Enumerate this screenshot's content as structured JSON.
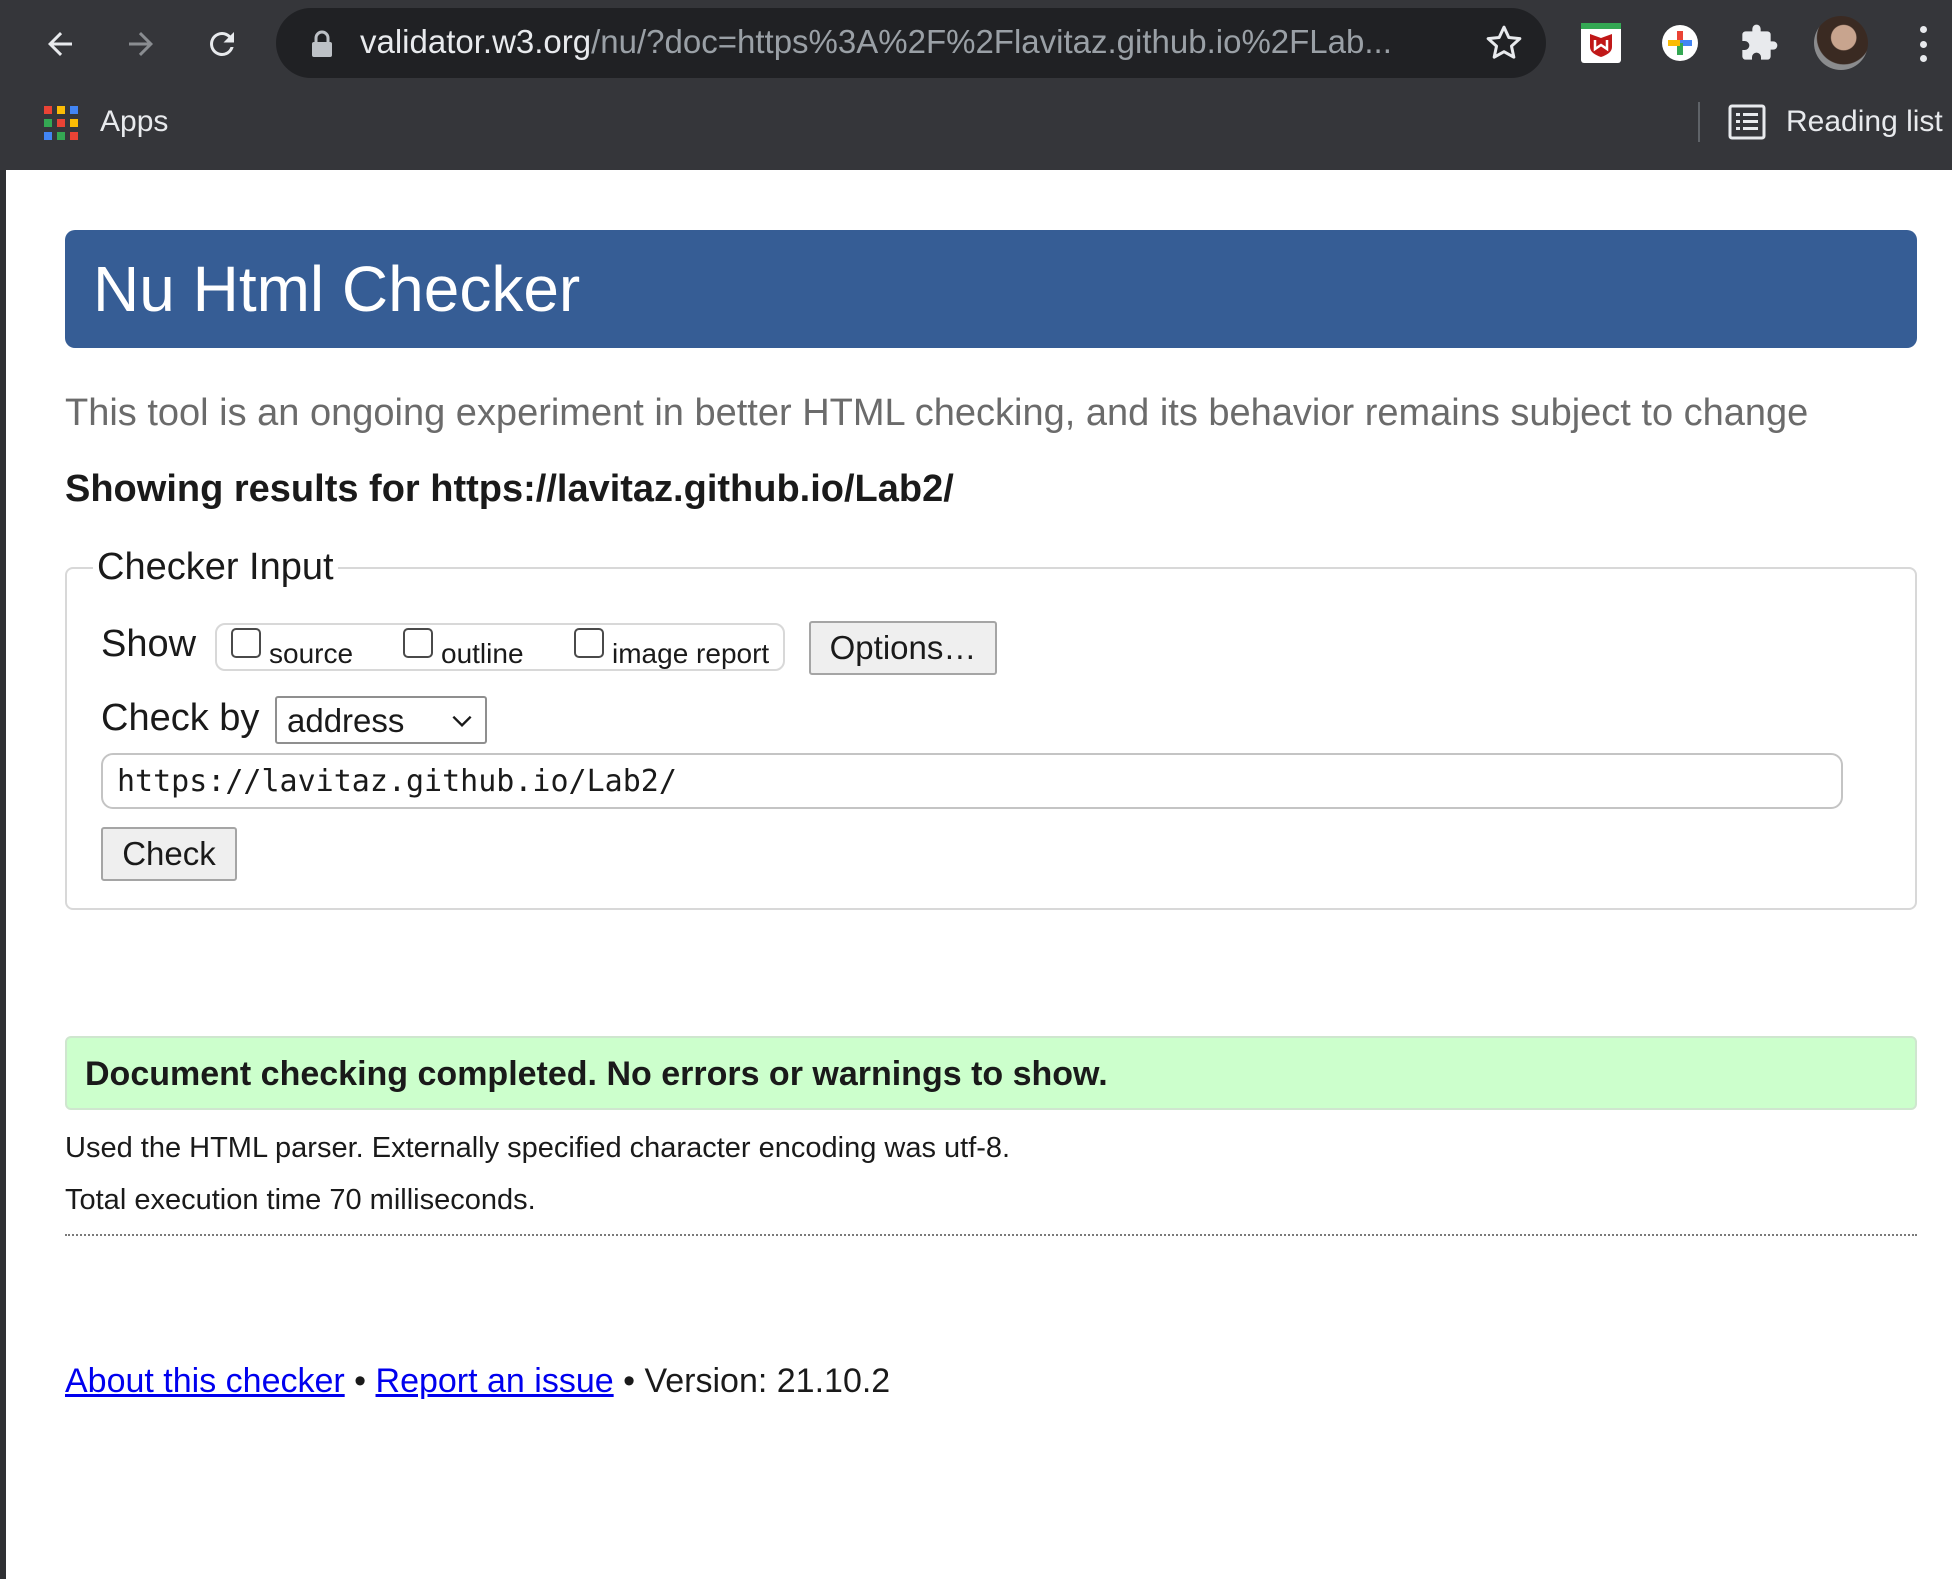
{
  "browser": {
    "url_host": "validator.w3.org",
    "url_rest": "/nu/?doc=https%3A%2F%2Flavitaz.github.io%2FLab...",
    "bookmarks": {
      "apps_label": "Apps",
      "reading_list_label": "Reading list"
    },
    "icons": [
      "back-arrow-icon",
      "forward-arrow-icon",
      "reload-icon",
      "lock-icon",
      "star-icon",
      "mcafee-extension-icon",
      "google-plus-extension-icon",
      "puzzle-extensions-icon",
      "profile-avatar",
      "kebab-menu-icon",
      "apps-grid-icon",
      "reading-list-icon"
    ]
  },
  "page": {
    "title": "Nu Html Checker",
    "tagline": "This tool is an ongoing experiment in better HTML checking, and its behavior remains subject to change",
    "showing_results": "Showing results for https://lavitaz.github.io/Lab2/",
    "checker_input": {
      "legend": "Checker Input",
      "show_label": "Show",
      "checkboxes": [
        {
          "label": "source",
          "checked": false
        },
        {
          "label": "outline",
          "checked": false
        },
        {
          "label": "image report",
          "checked": false
        }
      ],
      "options_button": "Options…",
      "check_by_label": "Check by",
      "check_by_value": "address",
      "url_value": "https://lavitaz.github.io/Lab2/",
      "check_button": "Check"
    },
    "result": {
      "message": "Document checking completed. No errors or warnings to show.",
      "parser_info": "Used the HTML parser. Externally specified character encoding was utf-8.",
      "execution_time": "Total execution time 70 milliseconds."
    },
    "footer": {
      "about_link": "About this checker",
      "separator": "•",
      "report_link": "Report an issue",
      "version": "Version: 21.10.2"
    }
  },
  "colors": {
    "chrome_bg": "#35363a",
    "omnibox_bg": "#202124",
    "banner_bg": "#365d95",
    "success_bg": "#ccffcc",
    "link": "#0000ee"
  }
}
